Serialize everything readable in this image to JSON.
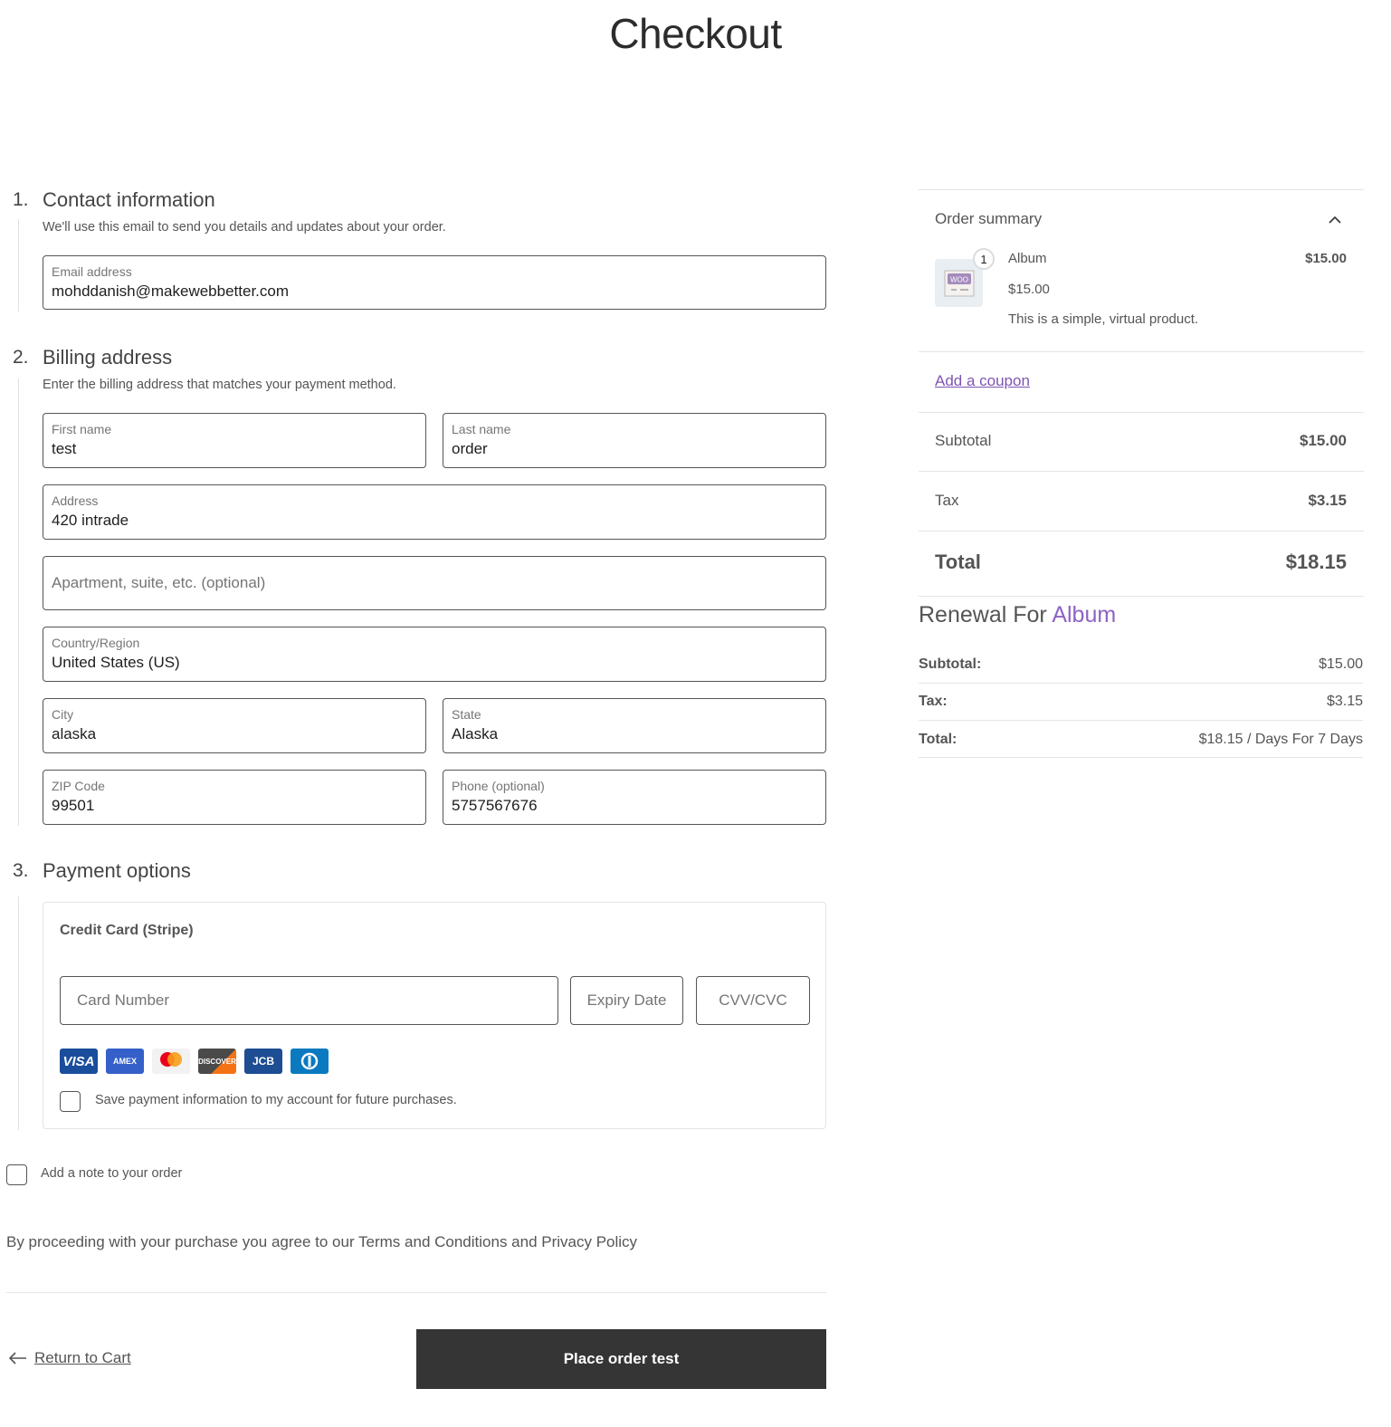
{
  "page": {
    "title": "Checkout"
  },
  "contact": {
    "number": "1.",
    "title": "Contact information",
    "description": "We'll use this email to send you details and updates about your order.",
    "email": {
      "label": "Email address",
      "value": "mohddanish@makewebbetter.com"
    }
  },
  "billing": {
    "number": "2.",
    "title": "Billing address",
    "description": "Enter the billing address that matches your payment method.",
    "first_name": {
      "label": "First name",
      "value": "test"
    },
    "last_name": {
      "label": "Last name",
      "value": "order"
    },
    "address": {
      "label": "Address",
      "value": "420 intrade"
    },
    "apartment": {
      "placeholder": "Apartment, suite, etc. (optional)"
    },
    "country": {
      "label": "Country/Region",
      "value": "United States (US)"
    },
    "city": {
      "label": "City",
      "value": "alaska"
    },
    "state": {
      "label": "State",
      "value": "Alaska"
    },
    "zip": {
      "label": "ZIP Code",
      "value": "99501"
    },
    "phone": {
      "label": "Phone (optional)",
      "value": "5757567676"
    }
  },
  "payment": {
    "number": "3.",
    "title": "Payment options",
    "method_title": "Credit Card (Stripe)",
    "card_number_placeholder": "Card Number",
    "expiry_placeholder": "Expiry Date",
    "cvc_placeholder": "CVV/CVC",
    "brands": [
      {
        "name": "visa",
        "label": "VISA",
        "color": "#1a4d9c"
      },
      {
        "name": "amex",
        "label": "AMEX",
        "color": "#3560c9"
      },
      {
        "name": "mastercard",
        "label": "",
        "color": "#f2f2f2"
      },
      {
        "name": "discover",
        "label": "DISCOVER",
        "color": "#4a4a4a"
      },
      {
        "name": "jcb",
        "label": "JCB",
        "color": "#1d4d93"
      },
      {
        "name": "diners",
        "label": "D",
        "color": "#0a79bf"
      }
    ],
    "save_info_label": "Save payment information to my account for future purchases.",
    "save_info_checked": false
  },
  "order_note": {
    "label": "Add a note to your order",
    "checked": false
  },
  "terms": "By proceeding with your purchase you agree to our Terms and Conditions and Privacy Policy",
  "actions": {
    "return_label": "Return to Cart",
    "place_order_label": "Place order test"
  },
  "summary": {
    "title": "Order summary",
    "item": {
      "quantity": "1",
      "name": "Album",
      "unit_price": "$15.00",
      "description": "This is a simple, virtual product.",
      "line_total": "$15.00",
      "thumb_text": "WOO"
    },
    "coupon_label": "Add a coupon",
    "subtotal": {
      "label": "Subtotal",
      "value": "$15.00"
    },
    "tax": {
      "label": "Tax",
      "value": "$3.15"
    },
    "total": {
      "label": "Total",
      "value": "$18.15"
    }
  },
  "renewal": {
    "prefix": "Renewal For",
    "product": "Album",
    "subtotal": {
      "label": "Subtotal:",
      "value": "$15.00"
    },
    "tax": {
      "label": "Tax:",
      "value": "$3.15"
    },
    "total": {
      "label": "Total:",
      "value": "$18.15 / Days For 7 Days"
    }
  },
  "colors": {
    "accent": "#7f54b3",
    "button": "#353535"
  }
}
